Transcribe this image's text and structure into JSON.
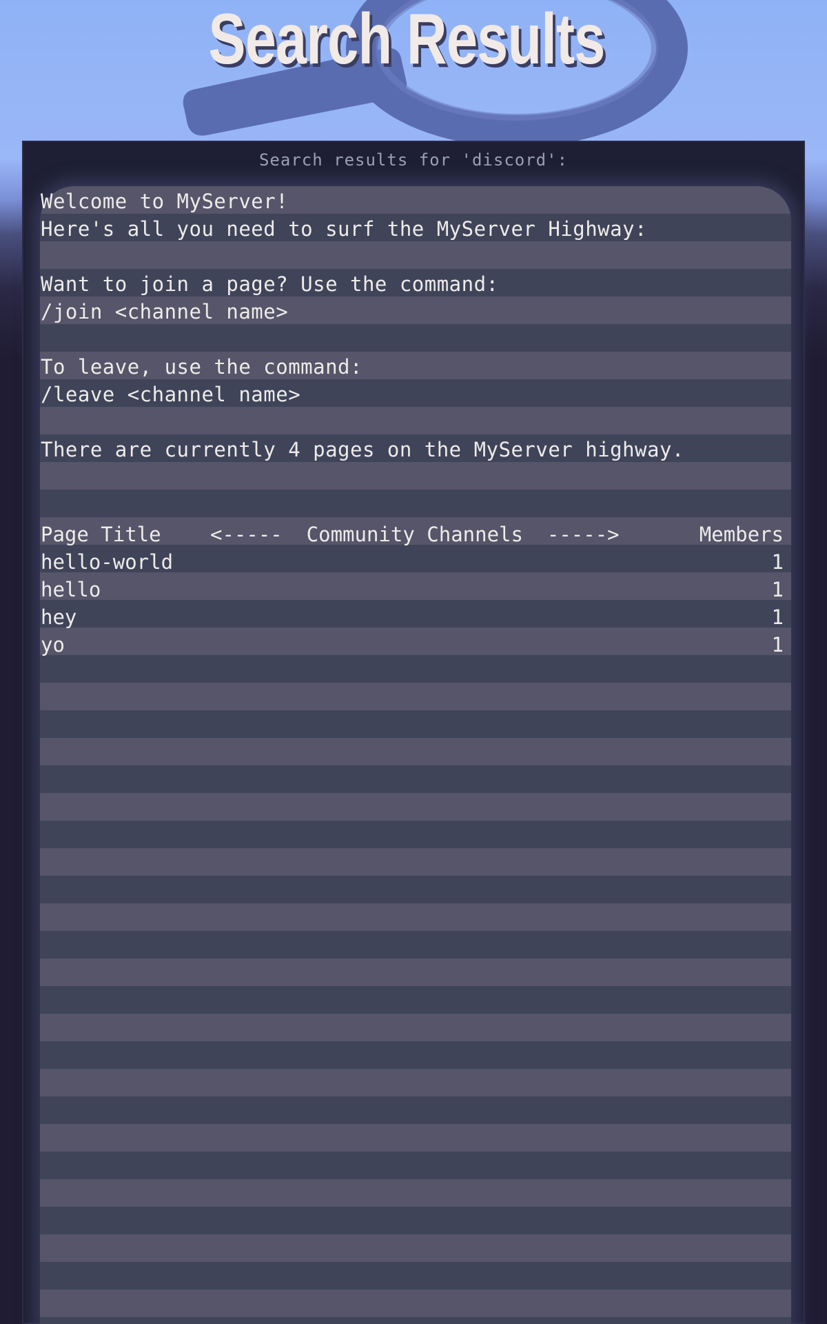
{
  "header": {
    "title": "Search Results",
    "background_icon": "magnifying-glass-icon"
  },
  "panel": {
    "caption": "Search results for 'discord':"
  },
  "intro_lines": [
    "Welcome to MyServer!",
    "Here's all you need to surf the MyServer Highway:",
    "",
    "Want to join a page? Use the command:",
    "/join <channel name>",
    "",
    "To leave, use the command:",
    "/leave <channel name>",
    "",
    "There are currently 4 pages on the MyServer highway."
  ],
  "table": {
    "headers": {
      "title": "Page Title",
      "middle": "<-----  Community Channels  ----->",
      "members": "Members"
    },
    "rows": [
      {
        "title": "hello-world",
        "members": "1"
      },
      {
        "title": "hello",
        "members": "1"
      },
      {
        "title": "hey",
        "members": "1"
      },
      {
        "title": "yo",
        "members": "1"
      }
    ]
  },
  "colors": {
    "sky": "#8fb2f6",
    "panel": "#1e1f34",
    "stripe_light": "#565569",
    "stripe_dark": "#3f4459",
    "text": "#eeebe9",
    "caption": "#9aa2b3"
  }
}
